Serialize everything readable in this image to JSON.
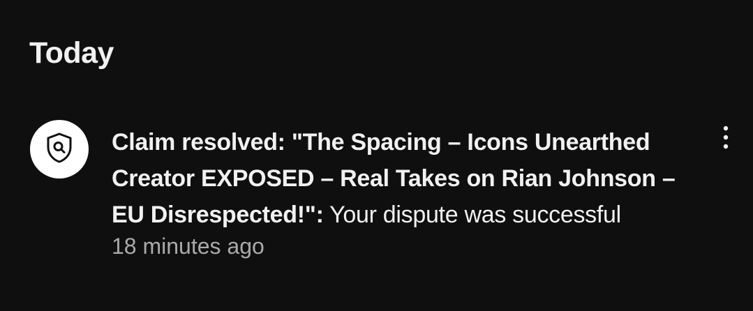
{
  "section": {
    "title": "Today"
  },
  "notification": {
    "icon": "shield-search-icon",
    "title_bold": "Claim resolved: \"The Spacing – Icons Unearthed Creator EXPOSED – Real Takes on Rian Johnson – EU Disrespected!\":",
    "message": " Your dispute was successful",
    "timestamp": "18 minutes ago",
    "menu_icon": "more-vertical-icon"
  },
  "colors": {
    "background": "#0f0f0f",
    "text_primary": "#f1f1f1",
    "text_secondary": "#aaaaaa",
    "avatar_bg": "#ffffff"
  }
}
